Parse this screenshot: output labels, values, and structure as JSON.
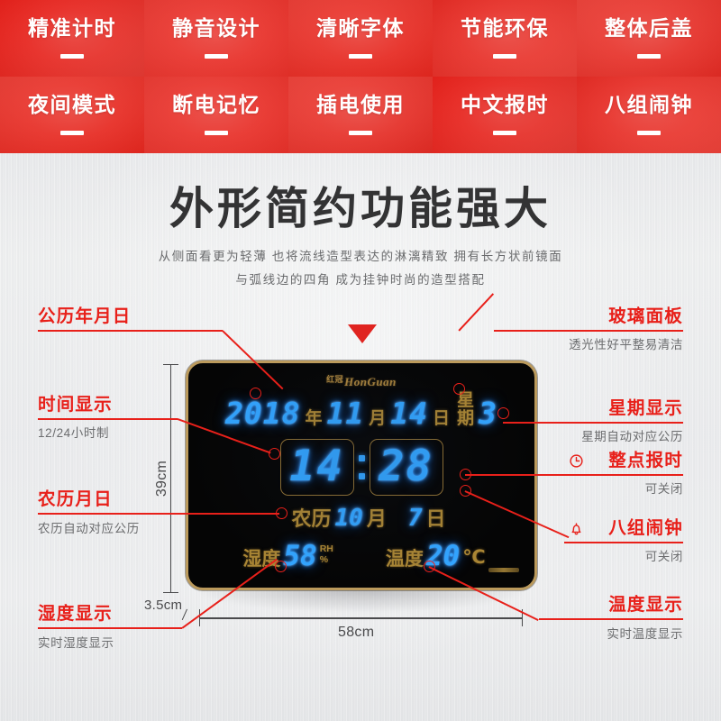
{
  "features": [
    {
      "label": "精准计时",
      "tone": "t0"
    },
    {
      "label": "静音设计",
      "tone": "t1"
    },
    {
      "label": "清晰字体",
      "tone": "t2"
    },
    {
      "label": "节能环保",
      "tone": "t3"
    },
    {
      "label": "整体后盖",
      "tone": "t4"
    },
    {
      "label": "夜间模式",
      "tone": "t2"
    },
    {
      "label": "断电记忆",
      "tone": "t1"
    },
    {
      "label": "插电使用",
      "tone": "t4"
    },
    {
      "label": "中文报时",
      "tone": "t0"
    },
    {
      "label": "八组闹钟",
      "tone": "t3"
    }
  ],
  "headline": {
    "title": "外形简约功能强大",
    "sub1": "从侧面看更为轻薄 也将流线造型表达的淋漓精致 拥有长方状前镜面",
    "sub2": "与弧线边的四角 成为挂钟时尚的造型搭配"
  },
  "clock": {
    "brand": "HonGuan",
    "brand_mark": "红冠",
    "date": {
      "year": "2018",
      "year_unit": "年",
      "month": "11",
      "month_unit": "月",
      "day": "14",
      "day_unit": "日",
      "week_label_top": "星",
      "week_label_bottom": "期",
      "weekday": "3"
    },
    "time": {
      "hour": "14",
      "minute": "28"
    },
    "lunar": {
      "label": "农历",
      "month": "10",
      "month_unit": "月",
      "day": "7",
      "day_unit": "日"
    },
    "humidity": {
      "label": "湿度",
      "value": "58",
      "unit_top": "RH",
      "unit_bottom": "%"
    },
    "temperature": {
      "label": "温度",
      "value": "20",
      "unit": "℃"
    }
  },
  "annotations": {
    "calendar": {
      "title": "公历年月日",
      "sub": ""
    },
    "time_display": {
      "title": "时间显示",
      "sub": "12/24小时制"
    },
    "lunar_display": {
      "title": "农历月日",
      "sub": "农历自动对应公历"
    },
    "humidity_display": {
      "title": "湿度显示",
      "sub": "实时湿度显示"
    },
    "glass_panel": {
      "title": "玻璃面板",
      "sub": "透光性好平整易清洁"
    },
    "weekday_display": {
      "title": "星期显示",
      "sub": "星期自动对应公历"
    },
    "hourly_chime": {
      "title": "整点报时",
      "sub": "可关闭",
      "icon": "clock-icon"
    },
    "alarms": {
      "title": "八组闹钟",
      "sub": "可关闭",
      "icon": "bell-icon"
    },
    "temperature_display": {
      "title": "温度显示",
      "sub": "实时温度显示"
    }
  },
  "dimensions": {
    "height": "39cm",
    "depth": "3.5cm",
    "width": "58cm"
  },
  "colors": {
    "brand_red": "#e8201a",
    "led_blue": "#32a4ff",
    "gold": "#a98534",
    "panel_border": "#bb9a5c"
  }
}
